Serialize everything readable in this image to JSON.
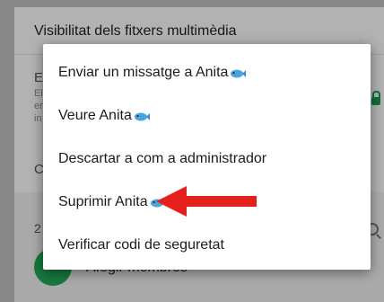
{
  "background": {
    "header_title": "Visibilitat dels fitxers multimèdia",
    "row_initial": "E",
    "row_initial_2": "C",
    "section_count": "2",
    "add_members": "Afegir membres"
  },
  "menu": {
    "items": [
      {
        "label": "Enviar un missatge a Anita",
        "has_fish": true
      },
      {
        "label": "Veure Anita",
        "has_fish": true
      },
      {
        "label": "Descartar a com a administrador",
        "has_fish": false
      },
      {
        "label": "Suprimir Anita",
        "has_fish": true
      },
      {
        "label": "Verificar codi de seguretat",
        "has_fish": false
      }
    ]
  },
  "colors": {
    "arrow": "#e3201b",
    "accent_green": "#1fa855",
    "fish_blue": "#4aa3df"
  },
  "icons": {
    "fish": "fish-emoji-icon",
    "arrow": "red-arrow-icon",
    "lock": "lock-icon",
    "search": "search-icon"
  }
}
